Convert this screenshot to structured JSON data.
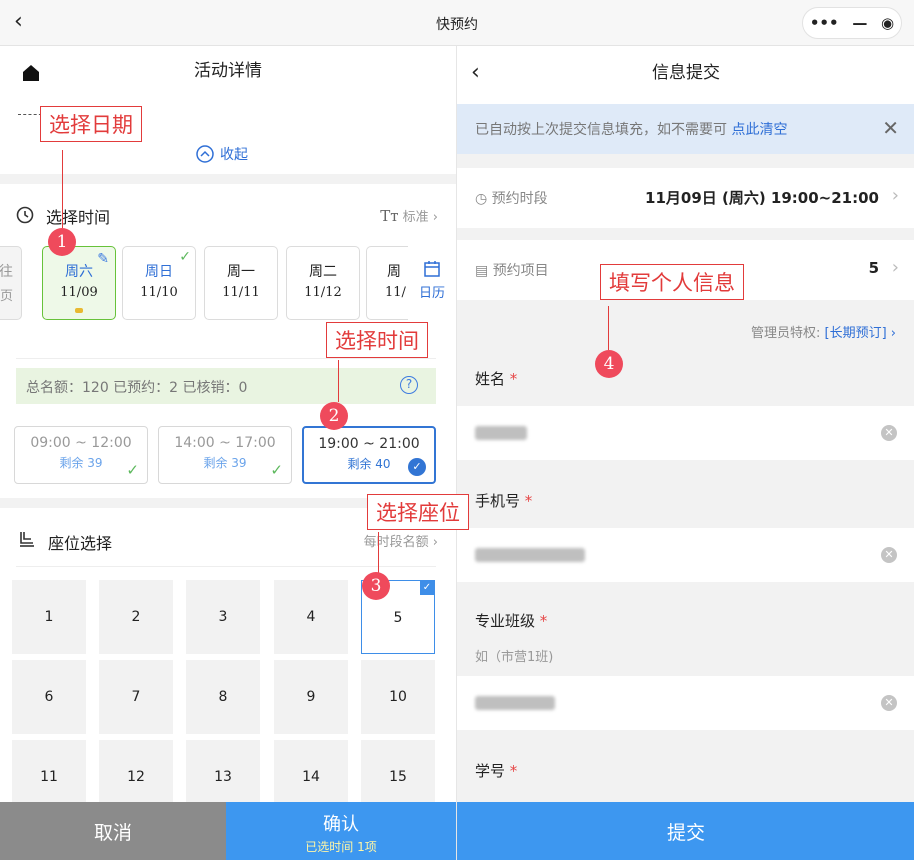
{
  "window": {
    "title": "快预约",
    "more": "•••",
    "minimize": "—",
    "record": "◉"
  },
  "left": {
    "title": "活动详情",
    "collapse_label": "收起",
    "time_section": {
      "title": "选择时间",
      "font_label": "标准"
    },
    "days": [
      {
        "week": "往",
        "date": "页"
      },
      {
        "week": "周六",
        "date": "11/09"
      },
      {
        "week": "周日",
        "date": "11/10"
      },
      {
        "week": "周一",
        "date": "11/11"
      },
      {
        "week": "周二",
        "date": "11/12"
      },
      {
        "week": "周",
        "date": "11/"
      }
    ],
    "calendar_label": "日历",
    "stats": "总名额：120  已预约：2  已核销：0",
    "slots": [
      {
        "time": "09:00 ~ 12:00",
        "remain": "剩余 39"
      },
      {
        "time": "14:00 ~ 17:00",
        "remain": "剩余 39"
      },
      {
        "time": "19:00 ~ 21:00",
        "remain": "剩余 40"
      }
    ],
    "seat_section": {
      "title": "座位选择",
      "right_label": "每时段名额"
    },
    "seats": [
      "1",
      "2",
      "3",
      "4",
      "5",
      "6",
      "7",
      "8",
      "9",
      "10",
      "11",
      "12",
      "13",
      "14",
      "15"
    ],
    "cancel": "取消",
    "confirm": "确认",
    "confirm_sub": "已选时间 1项"
  },
  "right": {
    "title": "信息提交",
    "notice": "已自动按上次提交信息填充，如不需要可",
    "notice_link": "点此清空",
    "period_label": "预约时段",
    "period_value": "11月09日 (周六) 19:00~21:00",
    "items_label": "预约项目",
    "items_value": "5",
    "admin_label": "管理员特权:",
    "admin_link": "[长期预订]",
    "fields": [
      {
        "label": "姓名",
        "req": "*"
      },
      {
        "label": "手机号",
        "req": "*"
      },
      {
        "label": "专业班级",
        "req": "*",
        "hint": "如（市营1班)"
      },
      {
        "label": "学号",
        "req": "*"
      }
    ],
    "submit": "提交"
  },
  "annotations": [
    {
      "text": "选择日期",
      "num": "1"
    },
    {
      "text": "选择时间",
      "num": "2"
    },
    {
      "text": "选择座位",
      "num": "3"
    },
    {
      "text": "填写个人信息",
      "num": "4"
    }
  ],
  "colors": {
    "accent": "#3d97f0",
    "annotation": "#e23b3b",
    "selected_day": "#67c23a"
  }
}
